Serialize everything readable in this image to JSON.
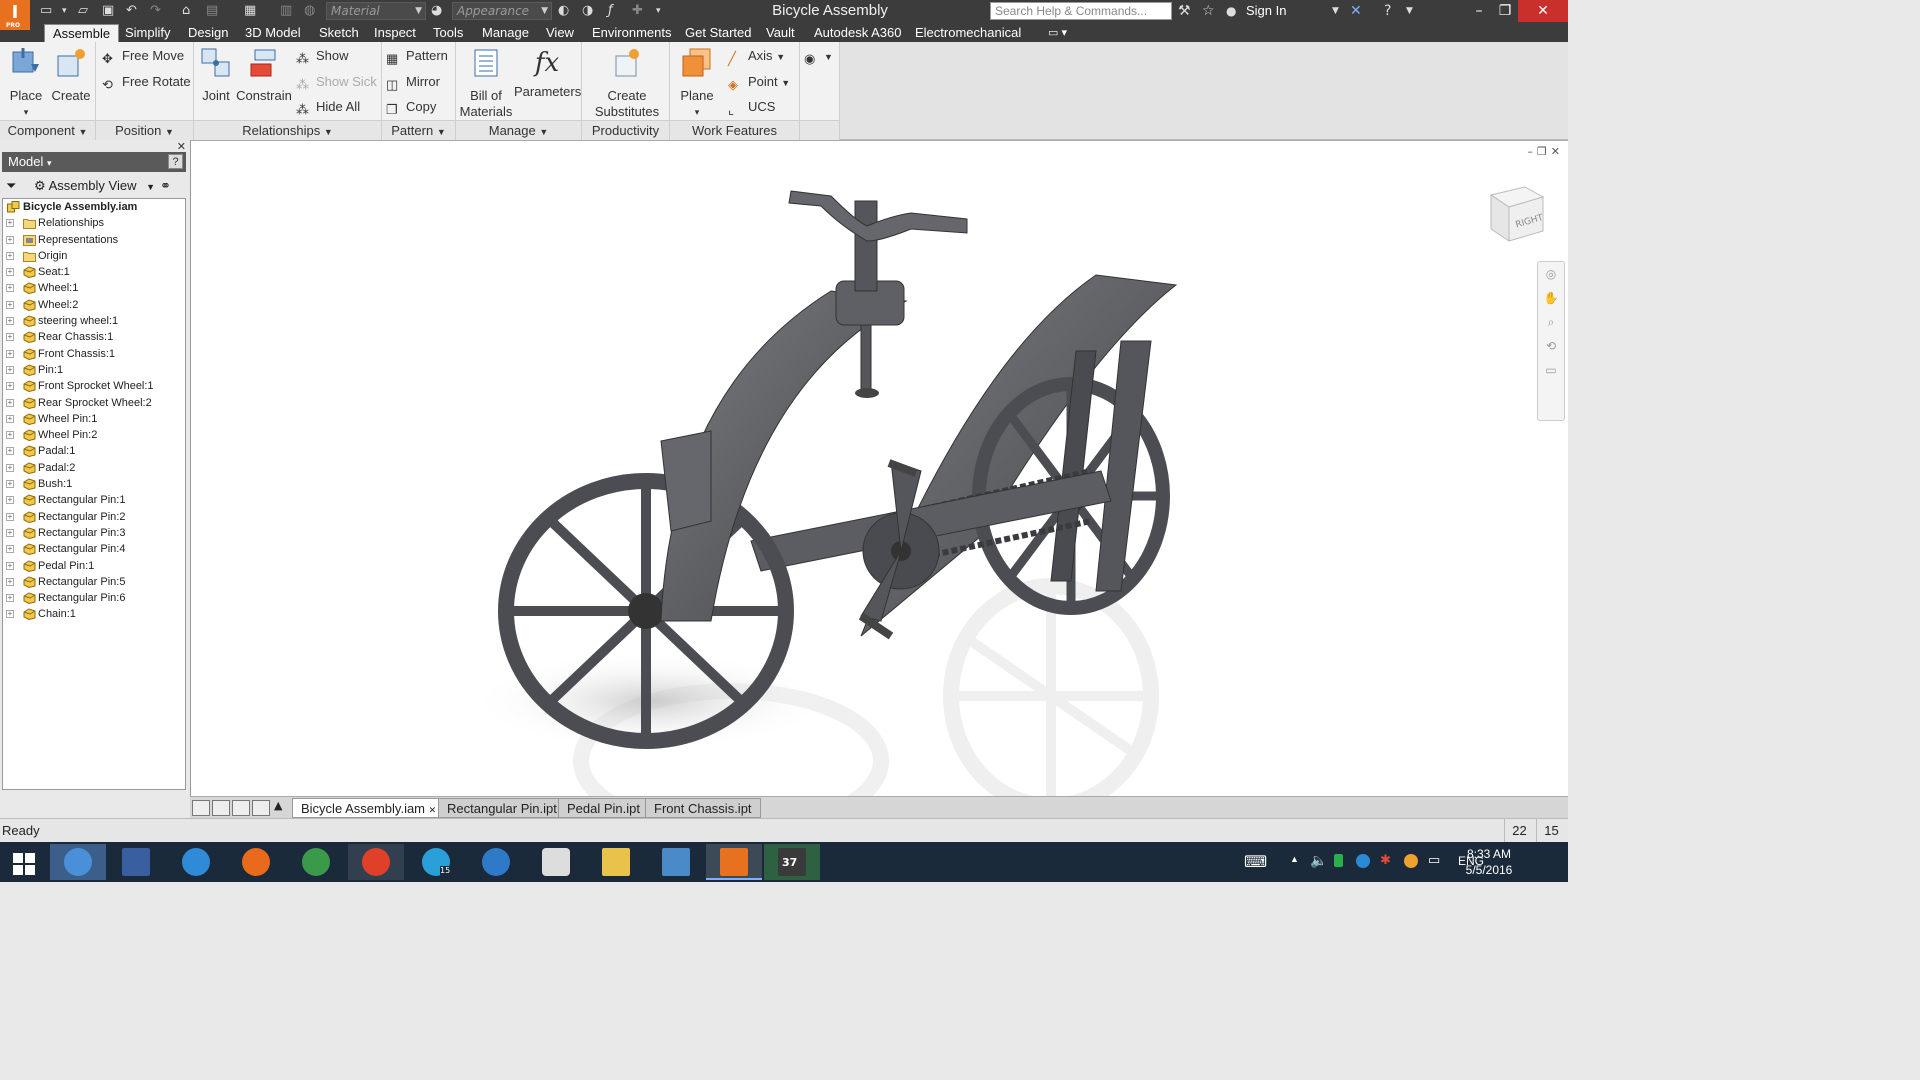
{
  "titlebar": {
    "app_logo": "I",
    "logo_sub": "PRO",
    "material_placeholder": "Material",
    "appearance_placeholder": "Appearance",
    "title": "Bicycle Assembly",
    "search_placeholder": "Search Help & Commands...",
    "signin": "Sign In"
  },
  "menu": {
    "tabs": [
      {
        "label": "Assemble",
        "active": true
      },
      {
        "label": "Simplify"
      },
      {
        "label": "Design"
      },
      {
        "label": "3D Model"
      },
      {
        "label": "Sketch"
      },
      {
        "label": "Inspect"
      },
      {
        "label": "Tools"
      },
      {
        "label": "Manage"
      },
      {
        "label": "View"
      },
      {
        "label": "Environments"
      },
      {
        "label": "Get Started"
      },
      {
        "label": "Vault"
      },
      {
        "label": "Autodesk A360"
      },
      {
        "label": "Electromechanical"
      }
    ]
  },
  "ribbon": {
    "component": {
      "place": "Place",
      "create": "Create",
      "footer": "Component"
    },
    "position": {
      "free_move": "Free Move",
      "free_rotate": "Free Rotate",
      "footer": "Position"
    },
    "relationships": {
      "joint": "Joint",
      "constrain": "Constrain",
      "show": "Show",
      "show_sick": "Show Sick",
      "hide_all": "Hide All",
      "footer": "Relationships"
    },
    "pattern": {
      "pattern": "Pattern",
      "mirror": "Mirror",
      "copy": "Copy",
      "footer": "Pattern"
    },
    "manage": {
      "bom_line1": "Bill of",
      "bom_line2": "Materials",
      "parameters": "Parameters",
      "footer": "Manage"
    },
    "productivity": {
      "line1": "Create",
      "line2": "Substitutes",
      "footer": "Productivity"
    },
    "work_features": {
      "plane": "Plane",
      "axis": "Axis",
      "point": "Point",
      "ucs": "UCS",
      "footer": "Work Features"
    }
  },
  "browser": {
    "title": "Model",
    "help": "?",
    "view": "Assembly View",
    "root": "Bicycle Assembly.iam",
    "items": [
      {
        "label": "Relationships",
        "icon": "folder"
      },
      {
        "label": "Representations",
        "icon": "rep"
      },
      {
        "label": "Origin",
        "icon": "folder"
      },
      {
        "label": "Seat:1",
        "icon": "part"
      },
      {
        "label": "Wheel:1",
        "icon": "part"
      },
      {
        "label": "Wheel:2",
        "icon": "part"
      },
      {
        "label": "steering wheel:1",
        "icon": "part"
      },
      {
        "label": "Rear Chassis:1",
        "icon": "part"
      },
      {
        "label": "Front Chassis:1",
        "icon": "part"
      },
      {
        "label": "Pin:1",
        "icon": "part"
      },
      {
        "label": "Front Sprocket Wheel:1",
        "icon": "part"
      },
      {
        "label": "Rear Sprocket Wheel:2",
        "icon": "part"
      },
      {
        "label": "Wheel Pin:1",
        "icon": "part"
      },
      {
        "label": "Wheel Pin:2",
        "icon": "part"
      },
      {
        "label": "Padal:1",
        "icon": "part"
      },
      {
        "label": "Padal:2",
        "icon": "part"
      },
      {
        "label": "Bush:1",
        "icon": "part"
      },
      {
        "label": "Rectangular Pin:1",
        "icon": "part"
      },
      {
        "label": "Rectangular Pin:2",
        "icon": "part"
      },
      {
        "label": "Rectangular Pin:3",
        "icon": "part"
      },
      {
        "label": "Rectangular Pin:4",
        "icon": "part"
      },
      {
        "label": "Pedal Pin:1",
        "icon": "part"
      },
      {
        "label": "Rectangular Pin:5",
        "icon": "part"
      },
      {
        "label": "Rectangular Pin:6",
        "icon": "part"
      },
      {
        "label": "Chain:1",
        "icon": "part"
      }
    ]
  },
  "viewport": {
    "viewcube_label": "RIGHT"
  },
  "doc_tabs": [
    {
      "label": "Bicycle Assembly.iam",
      "active": true
    },
    {
      "label": "Rectangular Pin.ipt"
    },
    {
      "label": "Pedal Pin.ipt"
    },
    {
      "label": "Front Chassis.ipt"
    }
  ],
  "status": {
    "text": "Ready",
    "count1": "22",
    "count2": "15"
  },
  "taskbar": {
    "lang": "ENG",
    "time": "8:33 AM",
    "date": "5/5/2016",
    "telegram_badge": "15",
    "calendar_badge": "37"
  },
  "colors": {
    "accent": "#e8711f",
    "model": "#5a5b60",
    "titlebar": "#3c3c3c"
  }
}
